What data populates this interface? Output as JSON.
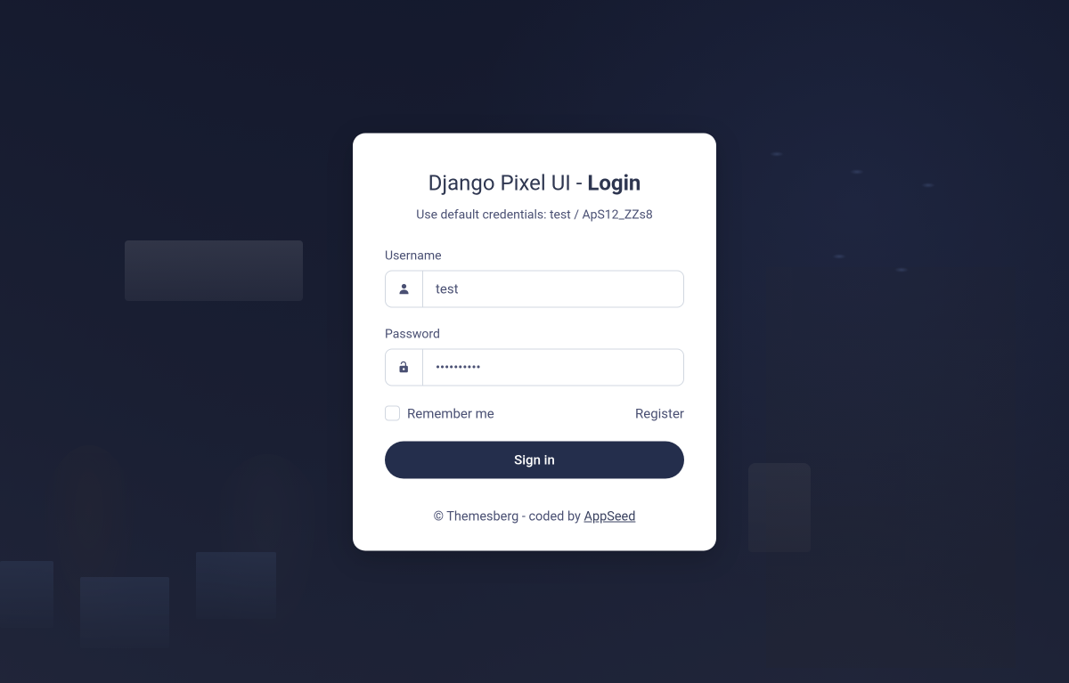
{
  "card": {
    "title_prefix": "Django Pixel UI - ",
    "title_bold": "Login",
    "subtitle": "Use default credentials: test / ApS12_ZZs8",
    "username_label": "Username",
    "username_value": "test",
    "password_label": "Password",
    "password_value": "••••••••••",
    "remember_label": "Remember me",
    "register_label": "Register",
    "signin_label": "Sign in",
    "footer_prefix": "© Themesberg - coded by ",
    "footer_link": "AppSeed"
  }
}
